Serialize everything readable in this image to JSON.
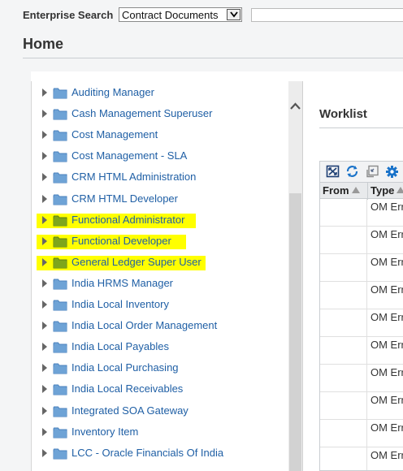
{
  "search": {
    "label": "Enterprise Search",
    "category": "Contract Documents",
    "query": ""
  },
  "page": {
    "title": "Home"
  },
  "navigator": {
    "items": [
      {
        "label": "Auditing Manager",
        "highlighted": false
      },
      {
        "label": "Cash Management Superuser",
        "highlighted": false
      },
      {
        "label": "Cost Management",
        "highlighted": false
      },
      {
        "label": "Cost Management - SLA",
        "highlighted": false
      },
      {
        "label": "CRM HTML Administration",
        "highlighted": false
      },
      {
        "label": "CRM HTML Developer",
        "highlighted": false
      },
      {
        "label": "Functional Administrator",
        "highlighted": true
      },
      {
        "label": "Functional Developer",
        "highlighted": true
      },
      {
        "label": "General Ledger Super User",
        "highlighted": true
      },
      {
        "label": "India HRMS Manager",
        "highlighted": false
      },
      {
        "label": "India Local Inventory",
        "highlighted": false
      },
      {
        "label": "India Local Order Management",
        "highlighted": false
      },
      {
        "label": "India Local Payables",
        "highlighted": false
      },
      {
        "label": "India Local Purchasing",
        "highlighted": false
      },
      {
        "label": "India Local Receivables",
        "highlighted": false
      },
      {
        "label": "Integrated SOA Gateway",
        "highlighted": false
      },
      {
        "label": "Inventory Item",
        "highlighted": false
      },
      {
        "label": "LCC - Oracle Financials Of India",
        "highlighted": false
      }
    ]
  },
  "worklist": {
    "title": "Worklist",
    "columns": {
      "from": "From",
      "type": "Type"
    },
    "rows": [
      {
        "from": "",
        "type": "OM Err"
      },
      {
        "from": "",
        "type": "OM Err"
      },
      {
        "from": "",
        "type": "OM Err"
      },
      {
        "from": "",
        "type": "OM Err"
      },
      {
        "from": "",
        "type": "OM Err"
      },
      {
        "from": "",
        "type": "OM Err"
      },
      {
        "from": "",
        "type": "OM Err"
      },
      {
        "from": "",
        "type": "OM Err"
      },
      {
        "from": "",
        "type": "OM Err"
      },
      {
        "from": "",
        "type": "OM Err"
      }
    ]
  },
  "colors": {
    "link": "#1f5fa5",
    "highlight": "#ffff00",
    "folder_default": "#6fa3d6",
    "folder_highlighted": "#7ea61c"
  }
}
